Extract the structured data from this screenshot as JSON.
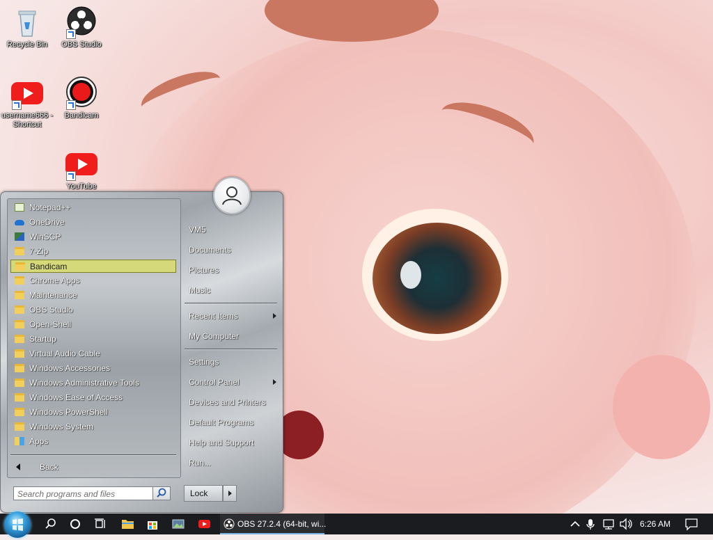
{
  "desktop": {
    "icons": [
      {
        "label": "Recycle Bin",
        "icon": "recycle-bin-icon"
      },
      {
        "label": "OBS Studio",
        "icon": "obs-icon"
      },
      {
        "label": "username666 - Shortcut",
        "icon": "youtube-icon"
      },
      {
        "label": "Bandicam",
        "icon": "bandicam-icon"
      },
      {
        "label": "YouTube",
        "icon": "youtube-icon"
      }
    ]
  },
  "start_menu": {
    "programs": [
      {
        "label": "Notepad++",
        "icon": "notepad-plus-icon"
      },
      {
        "label": "OneDrive",
        "icon": "onedrive-icon"
      },
      {
        "label": "WinSCP",
        "icon": "winscp-icon"
      },
      {
        "label": "7-Zip",
        "icon": "folder-icon"
      },
      {
        "label": "Bandicam",
        "icon": "folder-icon",
        "selected": true
      },
      {
        "label": "Chrome Apps",
        "icon": "folder-icon"
      },
      {
        "label": "Maintenance",
        "icon": "folder-icon"
      },
      {
        "label": "OBS Studio",
        "icon": "folder-icon"
      },
      {
        "label": "Open-Shell",
        "icon": "folder-icon"
      },
      {
        "label": "Startup",
        "icon": "folder-icon"
      },
      {
        "label": "Virtual Audio Cable",
        "icon": "folder-icon"
      },
      {
        "label": "Windows Accessories",
        "icon": "folder-icon"
      },
      {
        "label": "Windows Administrative Tools",
        "icon": "folder-icon"
      },
      {
        "label": "Windows Ease of Access",
        "icon": "folder-icon"
      },
      {
        "label": "Windows PowerShell",
        "icon": "folder-icon"
      },
      {
        "label": "Windows System",
        "icon": "folder-icon"
      },
      {
        "label": "Apps",
        "icon": "apps-icon"
      }
    ],
    "back_label": "Back",
    "search_placeholder": "Search programs and files",
    "right_items": [
      {
        "label": "VM5"
      },
      {
        "label": "Documents"
      },
      {
        "label": "Pictures"
      },
      {
        "label": "Music"
      },
      {
        "label": "Recent Items",
        "submenu": true
      },
      {
        "label": "My Computer"
      },
      {
        "label": "Settings"
      },
      {
        "label": "Control Panel",
        "submenu": true
      },
      {
        "label": "Devices and Printers"
      },
      {
        "label": "Default Programs"
      },
      {
        "label": "Help and Support"
      },
      {
        "label": "Run..."
      }
    ],
    "lock_label": "Lock"
  },
  "taskbar": {
    "obs_task_label": "OBS 27.2.4 (64-bit, wi...",
    "clock": "6:26 AM",
    "accent": "#7ab3e0"
  }
}
